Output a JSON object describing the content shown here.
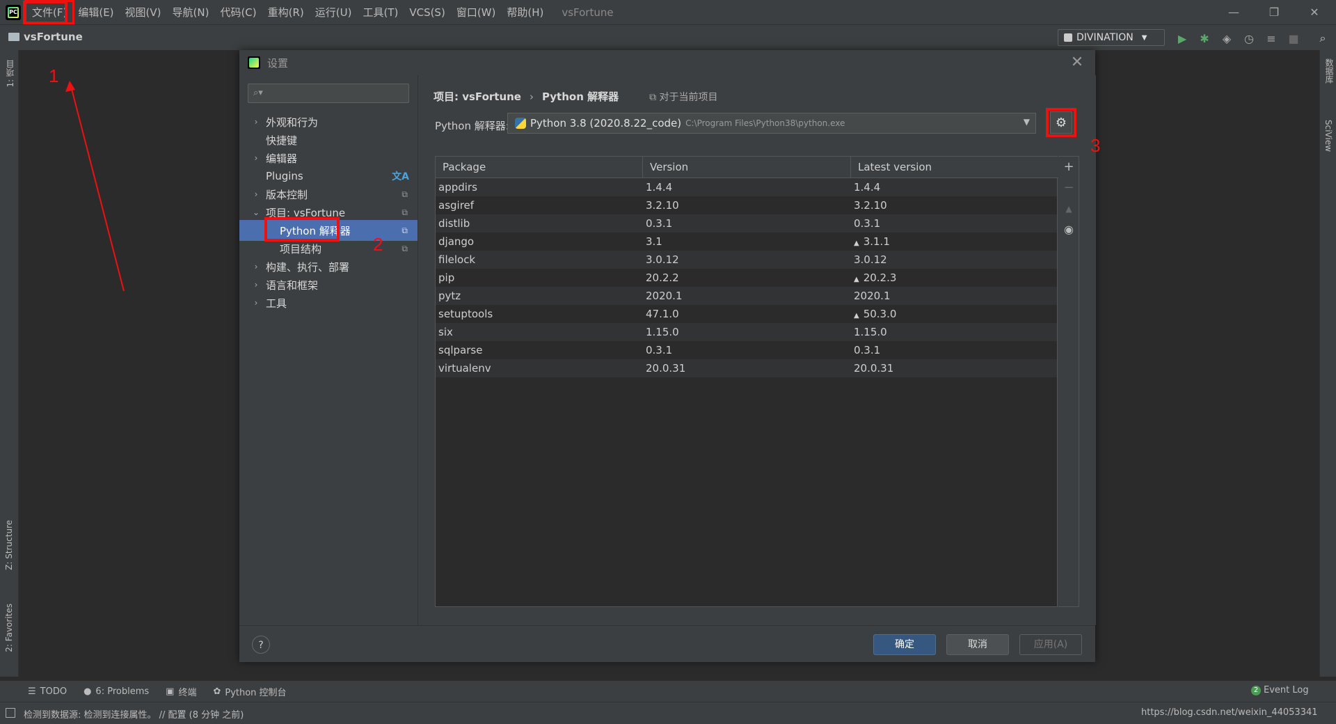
{
  "menubar": {
    "items": [
      "文件(F)",
      "编辑(E)",
      "视图(V)",
      "导航(N)",
      "代码(C)",
      "重构(R)",
      "运行(U)",
      "工具(T)",
      "VCS(S)",
      "窗口(W)",
      "帮助(H)"
    ],
    "window_title": "vsFortune",
    "logo_text": "PC"
  },
  "navbar": {
    "project": "vsFortune",
    "run_config": "DIVINATION"
  },
  "left_strip": {
    "project_tab": "1: 项目",
    "structure_tab": "Z: Structure",
    "favorites_tab": "2: Favorites"
  },
  "right_strip": {
    "database_tab": "数据库",
    "sciview_tab": "SciView"
  },
  "dialog": {
    "title": "设置",
    "search_placeholder": "",
    "tree": [
      {
        "label": "外观和行为",
        "expand": "›"
      },
      {
        "label": "快捷键"
      },
      {
        "label": "编辑器",
        "expand": "›"
      },
      {
        "label": "Plugins"
      },
      {
        "label": "版本控制",
        "expand": "›"
      },
      {
        "label": "项目: vsFortune",
        "expand": "⌄"
      },
      {
        "label": "Python 解释器"
      },
      {
        "label": "项目结构"
      },
      {
        "label": "构建、执行、部署",
        "expand": "›"
      },
      {
        "label": "语言和框架",
        "expand": "›"
      },
      {
        "label": "工具",
        "expand": "›"
      }
    ],
    "breadcrumb": {
      "project": "项目: vsFortune",
      "separator": "›",
      "page": "Python 解释器",
      "scope": "对于当前项目"
    },
    "interpreter": {
      "label": "Python 解释器:",
      "name": "Python 3.8 (2020.8.22_code)",
      "path": "C:\\Program Files\\Python38\\python.exe"
    },
    "table": {
      "columns": [
        "Package",
        "Version",
        "Latest version"
      ],
      "rows": [
        {
          "package": "appdirs",
          "version": "1.4.4",
          "latest": "1.4.4",
          "upgrade": false
        },
        {
          "package": "asgiref",
          "version": "3.2.10",
          "latest": "3.2.10",
          "upgrade": false
        },
        {
          "package": "distlib",
          "version": "0.3.1",
          "latest": "0.3.1",
          "upgrade": false
        },
        {
          "package": "django",
          "version": "3.1",
          "latest": "3.1.1",
          "upgrade": true
        },
        {
          "package": "filelock",
          "version": "3.0.12",
          "latest": "3.0.12",
          "upgrade": false
        },
        {
          "package": "pip",
          "version": "20.2.2",
          "latest": "20.2.3",
          "upgrade": true
        },
        {
          "package": "pytz",
          "version": "2020.1",
          "latest": "2020.1",
          "upgrade": false
        },
        {
          "package": "setuptools",
          "version": "47.1.0",
          "latest": "50.3.0",
          "upgrade": true
        },
        {
          "package": "six",
          "version": "1.15.0",
          "latest": "1.15.0",
          "upgrade": false
        },
        {
          "package": "sqlparse",
          "version": "0.3.1",
          "latest": "0.3.1",
          "upgrade": false
        },
        {
          "package": "virtualenv",
          "version": "20.0.31",
          "latest": "20.0.31",
          "upgrade": false
        }
      ]
    },
    "buttons": {
      "help": "?",
      "ok": "确定",
      "cancel": "取消",
      "apply": "应用(A)"
    }
  },
  "toolwindows": [
    "TODO",
    "6: Problems",
    "终端",
    "Python 控制台"
  ],
  "status": {
    "message": "检测到数据源: 检测到连接属性。 // 配置 (8 分钟 之前)",
    "event_log": "Event Log",
    "event_count": "2",
    "right_text": "https://blog.csdn.net/weixin_44053341"
  },
  "annotations": [
    "1",
    "2",
    "3"
  ],
  "colors": {
    "accent_selection": "#4b6eaf",
    "annotation_red": "#ee1111",
    "primary_button": "#365880"
  }
}
